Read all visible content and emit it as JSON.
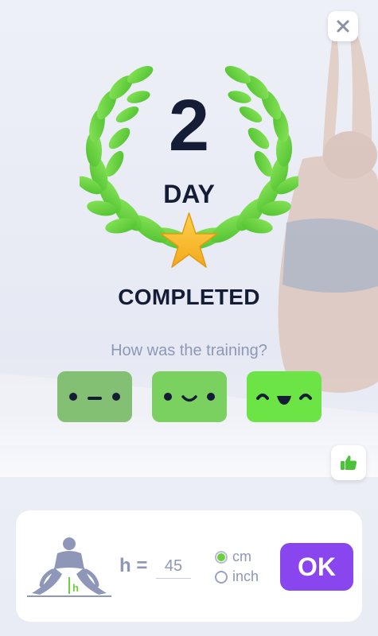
{
  "header": {
    "close_icon": "close-icon"
  },
  "achievement": {
    "day_number": "2",
    "day_word": "DAY",
    "completed_label": "COMPLETED",
    "wreath_icon": "laurel-wreath-icon",
    "star_icon": "star-icon"
  },
  "feedback": {
    "question": "How was the training?",
    "options": [
      {
        "name": "neutral-face",
        "color": "#84c074"
      },
      {
        "name": "smile-face",
        "color": "#7ad160"
      },
      {
        "name": "happy-face",
        "color": "#6ce446"
      }
    ],
    "like_icon": "thumbs-up-icon",
    "like_color": "#4cc23a"
  },
  "height_card": {
    "pose_icon": "wide-leg-stretch-icon",
    "h_label": "h =",
    "h_value": "45",
    "units": [
      {
        "label": "cm",
        "selected": true
      },
      {
        "label": "inch",
        "selected": false
      }
    ],
    "ok_label": "OK",
    "accent": "#8a46ee"
  }
}
